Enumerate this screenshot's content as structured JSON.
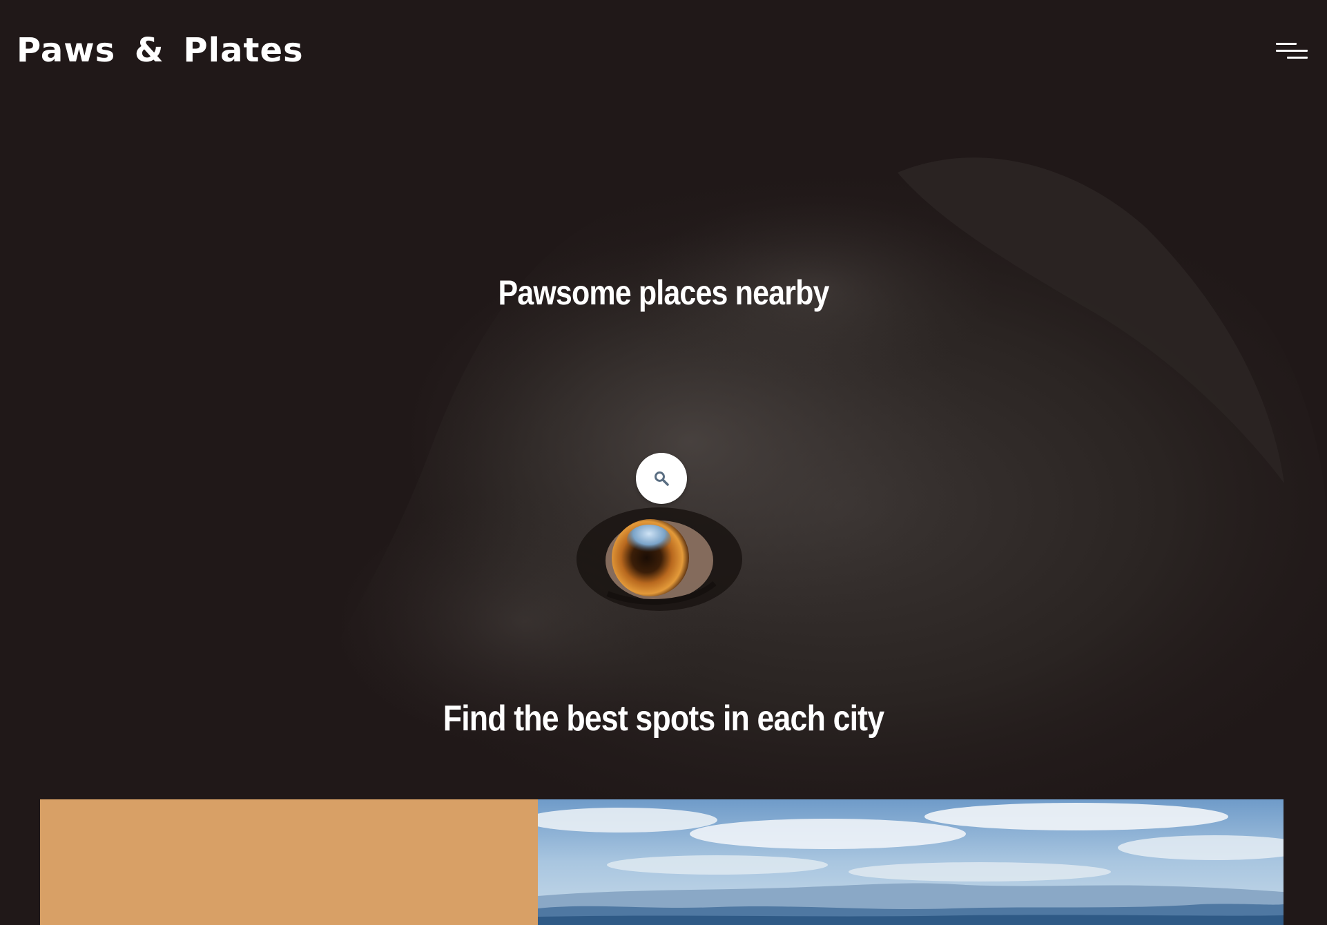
{
  "header": {
    "brand": "Paws & Plates",
    "menu_icon": "hamburger-menu-icon"
  },
  "hero": {
    "title": "Pawsome places nearby",
    "subtitle": "Find the best spots in each city",
    "background_image": "black-dog-close-up",
    "search_icon": "search-icon"
  },
  "feature_card": {
    "accent_color": "#d8a066",
    "image": "city-valley-landscape"
  },
  "colors": {
    "background": "#201818",
    "text": "#ffffff",
    "accent": "#d8a066",
    "search_icon_color": "#5a6e82"
  }
}
